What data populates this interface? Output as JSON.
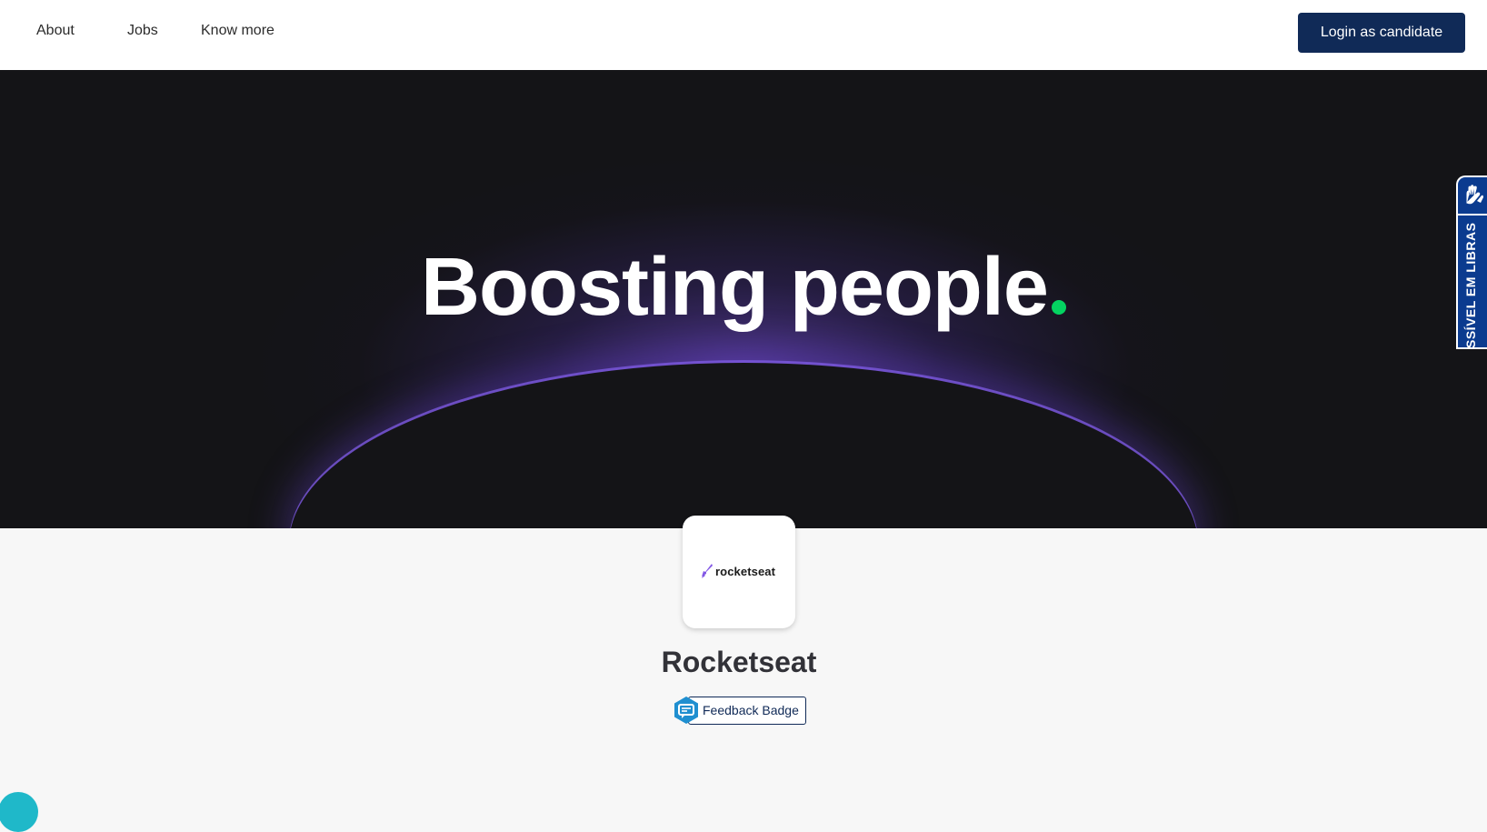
{
  "nav": {
    "links": [
      "About",
      "Jobs",
      "Know more"
    ],
    "login_label": "Login as candidate"
  },
  "hero": {
    "title": "Boosting people",
    "dot_color": "#04d361",
    "glow_color": "#764edc"
  },
  "libras": {
    "label": "SSÍVEL EM LIBRAS",
    "icon": "sign-language-hands-icon"
  },
  "company": {
    "logo_text": "rocketseat",
    "name": "Rocketseat"
  },
  "feedback": {
    "label": "Feedback Badge",
    "icon": "feedback-hexagon-icon"
  },
  "chat": {
    "icon": "chat-bubble-icon"
  },
  "colors": {
    "brand_navy": "#102a57",
    "hero_bg": "#141417",
    "page_bg": "#f7f7f7",
    "accent_green": "#04d361",
    "libras_blue": "#0b3b8f",
    "chat_teal": "#1fb8c9"
  }
}
